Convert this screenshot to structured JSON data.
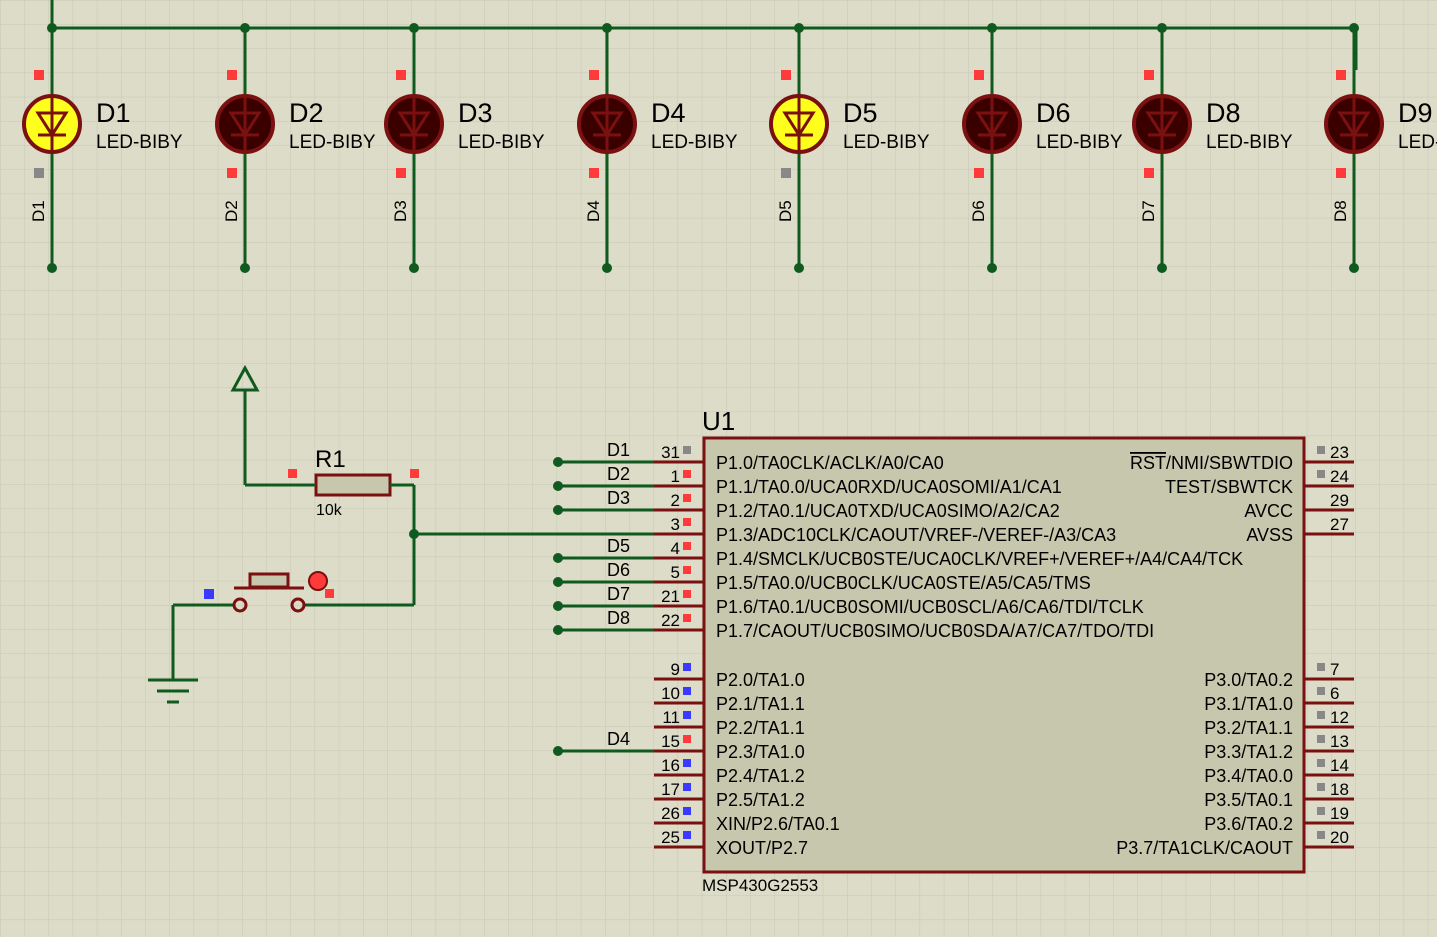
{
  "colors": {
    "grid": "#c6c6b2",
    "background": "#dcdcc8",
    "wire": "#0f5a1e",
    "component_outline": "#7a1010",
    "chip_fill": "#c7c7ae",
    "led_on": "#ffff1e",
    "led_off": "#3a0000",
    "pin_marker_red": "#ff3a3a",
    "pin_marker_blue": "#3a3aff",
    "pin_marker_grey": "#888888"
  },
  "leds": [
    {
      "ref": "D1",
      "part": "LED-BIBY",
      "net": "D1",
      "lit": true
    },
    {
      "ref": "D2",
      "part": "LED-BIBY",
      "net": "D2",
      "lit": false
    },
    {
      "ref": "D3",
      "part": "LED-BIBY",
      "net": "D3",
      "lit": false
    },
    {
      "ref": "D4",
      "part": "LED-BIBY",
      "net": "D4",
      "lit": false
    },
    {
      "ref": "D5",
      "part": "LED-BIBY",
      "net": "D5",
      "lit": true
    },
    {
      "ref": "D6",
      "part": "LED-BIBY",
      "net": "D6",
      "lit": false
    },
    {
      "ref": "D8",
      "part": "LED-BIBY",
      "net": "D7",
      "lit": false
    },
    {
      "ref": "D9",
      "part": "LED-BIBY",
      "net": "D8",
      "lit": false
    }
  ],
  "resistor": {
    "ref": "R1",
    "value": "10k"
  },
  "chip": {
    "ref": "U1",
    "part": "MSP430G2553",
    "left_pins": [
      {
        "num": "31",
        "name": "P1.0/TA0CLK/ACLK/A0/CA0",
        "net": "D1",
        "marker": "grey"
      },
      {
        "num": "1",
        "name": "P1.1/TA0.0/UCA0RXD/UCA0SOMI/A1/CA1",
        "net": "D2",
        "marker": "red"
      },
      {
        "num": "2",
        "name": "P1.2/TA0.1/UCA0TXD/UCA0SIMO/A2/CA2",
        "net": "D3",
        "marker": "red"
      },
      {
        "num": "3",
        "name": "P1.3/ADC10CLK/CAOUT/VREF-/VEREF-/A3/CA3",
        "net": "",
        "marker": "red"
      },
      {
        "num": "4",
        "name": "P1.4/SMCLK/UCB0STE/UCA0CLK/VREF+/VEREF+/A4/CA4/TCK",
        "net": "D5",
        "marker": "red"
      },
      {
        "num": "5",
        "name": "P1.5/TA0.0/UCB0CLK/UCA0STE/A5/CA5/TMS",
        "net": "D6",
        "marker": "red"
      },
      {
        "num": "21",
        "name": "P1.6/TA0.1/UCB0SOMI/UCB0SCL/A6/CA6/TDI/TCLK",
        "net": "D7",
        "marker": "red"
      },
      {
        "num": "22",
        "name": "P1.7/CAOUT/UCB0SIMO/UCB0SDA/A7/CA7/TDO/TDI",
        "net": "D8",
        "marker": "red"
      },
      {
        "num": "9",
        "name": "P2.0/TA1.0",
        "net": "",
        "marker": "blue"
      },
      {
        "num": "10",
        "name": "P2.1/TA1.1",
        "net": "",
        "marker": "blue"
      },
      {
        "num": "11",
        "name": "P2.2/TA1.1",
        "net": "",
        "marker": "blue"
      },
      {
        "num": "15",
        "name": "P2.3/TA1.0",
        "net": "D4",
        "marker": "red"
      },
      {
        "num": "16",
        "name": "P2.4/TA1.2",
        "net": "",
        "marker": "blue"
      },
      {
        "num": "17",
        "name": "P2.5/TA1.2",
        "net": "",
        "marker": "blue"
      },
      {
        "num": "26",
        "name": "XIN/P2.6/TA0.1",
        "net": "",
        "marker": "blue"
      },
      {
        "num": "25",
        "name": "XOUT/P2.7",
        "net": "",
        "marker": "blue"
      }
    ],
    "right_pins": [
      {
        "num": "23",
        "name_overbar": "RST",
        "name": "/NMI/SBWTDIO",
        "marker": "grey"
      },
      {
        "num": "24",
        "name_overbar": "",
        "name": "TEST/SBWTCK",
        "marker": "grey"
      },
      {
        "num": "29",
        "name_overbar": "",
        "name": "AVCC",
        "marker": "none"
      },
      {
        "num": "27",
        "name_overbar": "",
        "name": "AVSS",
        "marker": "none"
      },
      {
        "num": "7",
        "name_overbar": "",
        "name": "P3.0/TA0.2",
        "marker": "grey"
      },
      {
        "num": "6",
        "name_overbar": "",
        "name": "P3.1/TA1.0",
        "marker": "grey"
      },
      {
        "num": "12",
        "name_overbar": "",
        "name": "P3.2/TA1.1",
        "marker": "grey"
      },
      {
        "num": "13",
        "name_overbar": "",
        "name": "P3.3/TA1.2",
        "marker": "grey"
      },
      {
        "num": "14",
        "name_overbar": "",
        "name": "P3.4/TA0.0",
        "marker": "grey"
      },
      {
        "num": "18",
        "name_overbar": "",
        "name": "P3.5/TA0.1",
        "marker": "grey"
      },
      {
        "num": "19",
        "name_overbar": "",
        "name": "P3.6/TA0.2",
        "marker": "grey"
      },
      {
        "num": "20",
        "name_overbar": "",
        "name": "P3.7/TA1CLK/CAOUT",
        "marker": "grey"
      }
    ]
  }
}
